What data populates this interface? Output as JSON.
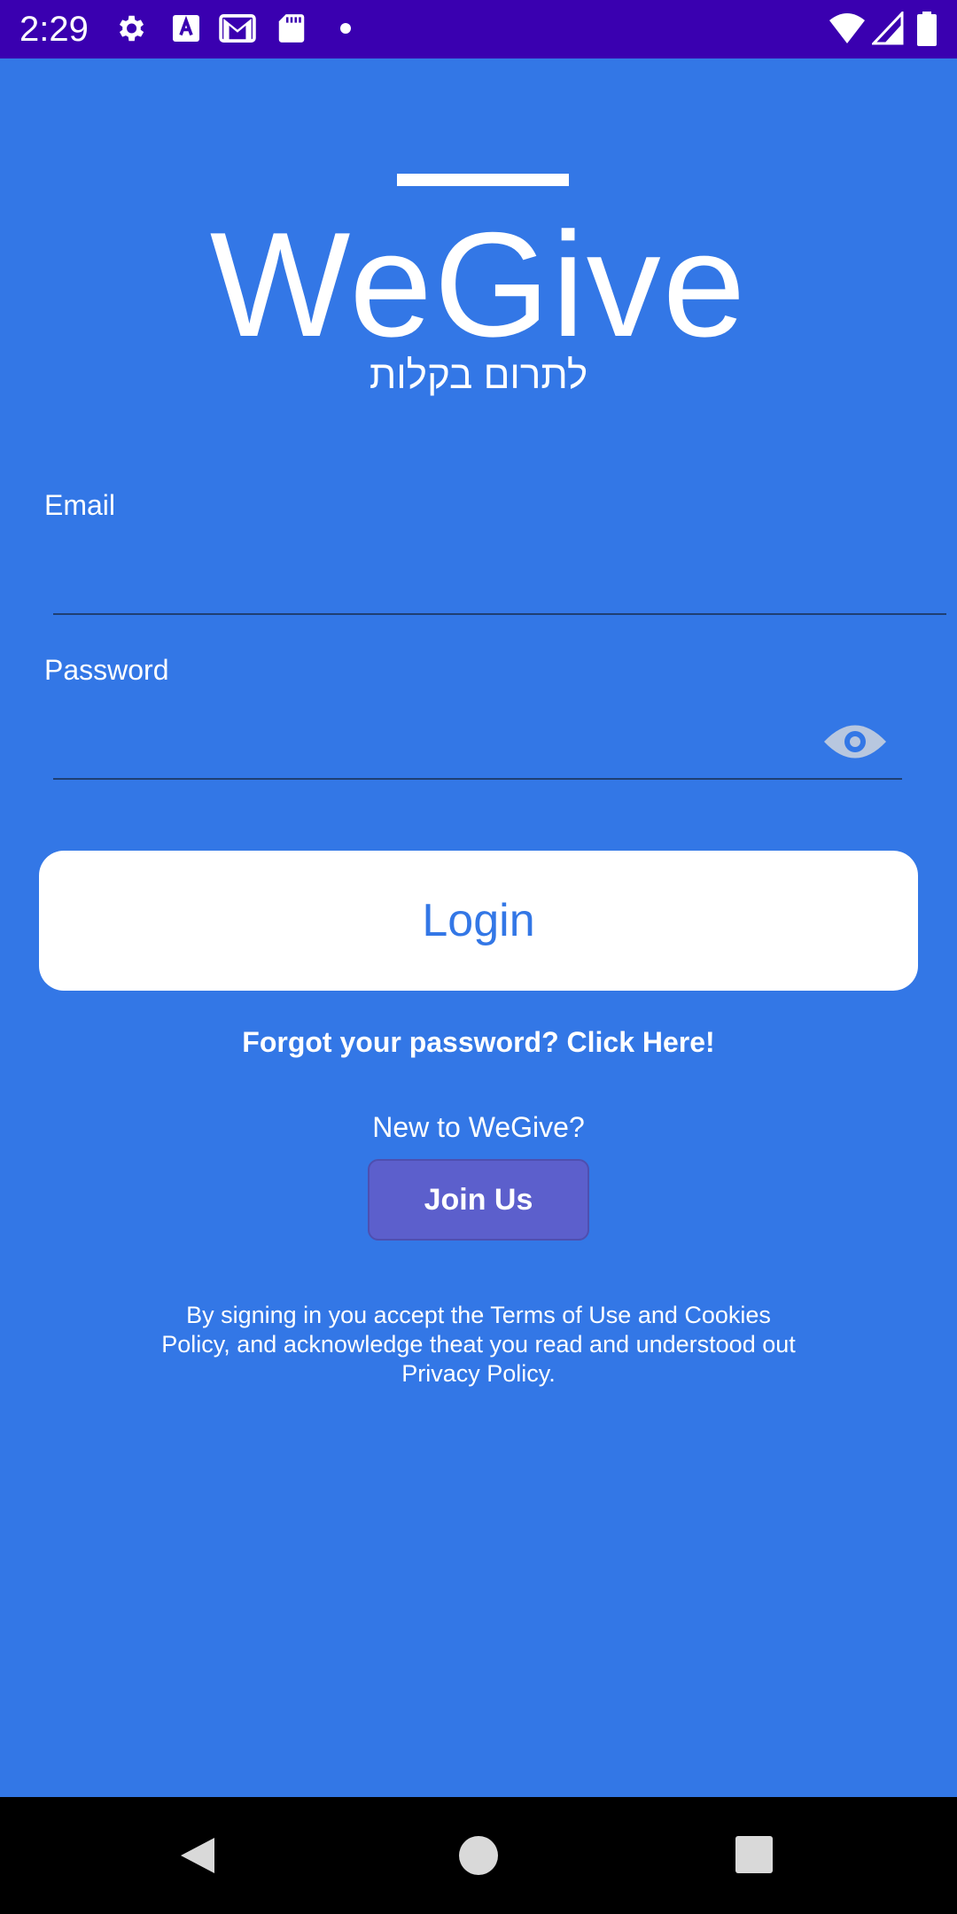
{
  "status_bar": {
    "time": "2:29",
    "icons": [
      "settings-icon",
      "a-icon",
      "gmail-icon",
      "sd-card-icon",
      "dot-icon",
      "wifi-icon",
      "signal-icon",
      "battery-icon"
    ],
    "background": "#3a00b0"
  },
  "logo": {
    "title": "WeGive",
    "tagline": "לתרום בקלות"
  },
  "form": {
    "email_label": "Email",
    "email_value": "",
    "password_label": "Password",
    "password_value": "",
    "password_visibility_icon": "eye-icon"
  },
  "actions": {
    "login_label": "Login",
    "forgot_text": "Forgot your password? Click Here!",
    "new_user_text": "New to WeGive?",
    "join_label": "Join Us"
  },
  "legal": {
    "text": "By signing in you accept the Terms of Use and Cookies Policy, and acknowledge theat you read and understood out Privacy Policy."
  },
  "nav_bar": {
    "icons": [
      "back-icon",
      "home-icon",
      "recents-icon"
    ]
  },
  "colors": {
    "background": "#3377e6",
    "accent": "#3377e6",
    "join_button": "#5c5fcc",
    "login_button": "#ffffff"
  }
}
